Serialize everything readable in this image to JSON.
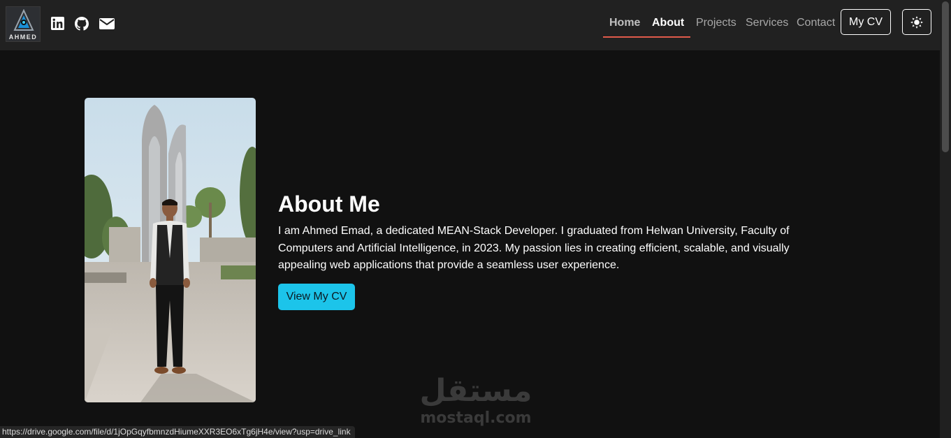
{
  "brand": {
    "logo_text": "AHMED"
  },
  "social": [
    {
      "name": "linkedin-icon",
      "label": "LinkedIn"
    },
    {
      "name": "github-icon",
      "label": "GitHub"
    },
    {
      "name": "envelope-icon",
      "label": "Email"
    }
  ],
  "nav": {
    "items": [
      {
        "label": "Home",
        "state": "visited"
      },
      {
        "label": "About",
        "state": "active"
      },
      {
        "label": "Projects",
        "state": "normal"
      },
      {
        "label": "Services",
        "state": "normal"
      },
      {
        "label": "Contact",
        "state": "normal"
      }
    ],
    "cv_button": "My CV",
    "theme_icon": "sun-icon"
  },
  "about": {
    "title": "About Me",
    "text": "I am Ahmed Emad, a dedicated MEAN-Stack Developer. I graduated from Helwan University, Faculty of Computers and Artificial Intelligence, in 2023. My passion lies in creating efficient, scalable, and visually appealing web applications that provide a seamless user experience.",
    "button": "View My CV"
  },
  "status_bar": {
    "url": "https://drive.google.com/file/d/1jOpGqyfbmnzdHiumeXXR3EO6xTg6jH4e/view?usp=drive_link"
  },
  "watermark": {
    "arabic": "مستقل",
    "latin": "mostaql.com"
  },
  "colors": {
    "background": "#111111",
    "navbar": "#212121",
    "accent": "#1cc4ea",
    "nav_underline": "#e05a4b"
  }
}
